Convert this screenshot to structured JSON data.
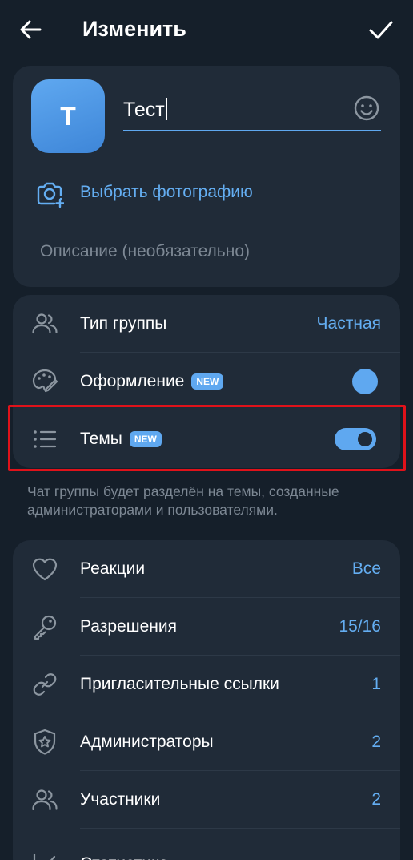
{
  "header": {
    "title": "Изменить",
    "back_icon": "arrow-left-icon",
    "done_icon": "check-icon"
  },
  "profile": {
    "avatar_letter": "Т",
    "name_value": "Тест",
    "emoji_icon": "smile-icon",
    "choose_photo": "Выбрать фотографию",
    "description_placeholder": "Описание (необязательно)"
  },
  "settings": {
    "group_type": {
      "label": "Тип группы",
      "value": "Частная",
      "icon": "users-icon"
    },
    "appearance": {
      "label": "Оформление",
      "badge": "NEW",
      "icon": "palette-icon"
    },
    "topics": {
      "label": "Темы",
      "badge": "NEW",
      "icon": "list-icon",
      "enabled": true
    },
    "topics_hint": "Чат группы будет разделён на темы, созданные администраторами и пользователями."
  },
  "management": [
    {
      "label": "Реакции",
      "value": "Все",
      "icon": "heart-icon"
    },
    {
      "label": "Разрешения",
      "value": "15/16",
      "icon": "key-icon"
    },
    {
      "label": "Пригласительные ссылки",
      "value": "1",
      "icon": "link-icon"
    },
    {
      "label": "Администраторы",
      "value": "2",
      "icon": "shield-star-icon"
    },
    {
      "label": "Участники",
      "value": "2",
      "icon": "users-icon"
    },
    {
      "label": "Статистика",
      "value": "",
      "icon": "stats-icon"
    }
  ],
  "colors": {
    "background": "#151f2a",
    "card": "#202b38",
    "accent": "#5fa8f0",
    "highlight": "#e0121a"
  }
}
